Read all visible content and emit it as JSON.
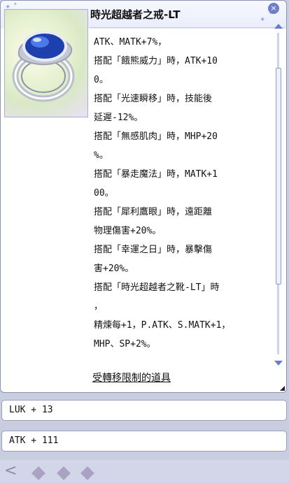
{
  "item": {
    "title": "時光超越者之戒-LT",
    "close_glyph": "×",
    "image_icon": "sapphire-ring-icon",
    "description_lines": [
      "ATK、MATK+7%，",
      "搭配「餓熊威力」時，ATK+10",
      "0。",
      "搭配「光速瞬移」時，技能後",
      "延遲-12%。",
      "搭配「無感肌肉」時，MHP+20",
      "%。",
      "搭配「暴走魔法」時，MATK+1",
      "00。",
      "搭配「犀利鷹眼」時，遠距離",
      "物理傷害+20%。",
      "搭配「幸運之日」時，暴擊傷",
      "害+20%。",
      "搭配「時光超越者之靴-LT」時",
      "，",
      "精煉每+1，P.ATK、S.MATK+1，",
      "MHP、SP+2%。"
    ],
    "restriction_link": "受轉移限制的道具"
  },
  "stats": {
    "luk_line": "LUK + 13",
    "atk_line": "ATK + 111"
  },
  "footer": {
    "left_glyph": "<"
  },
  "colors": {
    "accent": "#6a7ad0",
    "window_border": "#8c93b8",
    "background": "#c9cde0"
  }
}
